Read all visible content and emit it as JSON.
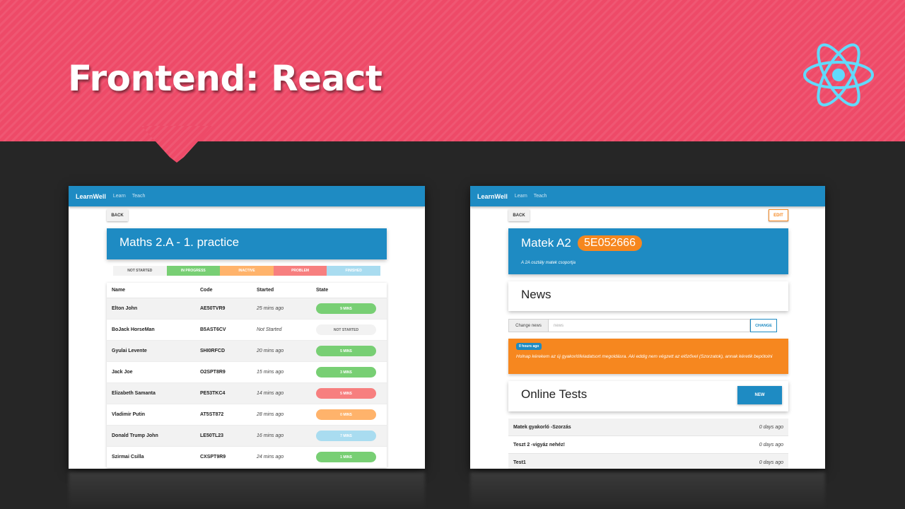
{
  "slide": {
    "title": "Frontend: React",
    "colors": {
      "banner": "#ee4a68",
      "background": "#262626",
      "react": "#61dafb"
    },
    "logo_icon": "react-atom-icon"
  },
  "left_app": {
    "nav": {
      "brand": "LearnWell",
      "links": [
        "Learn",
        "Teach"
      ]
    },
    "back_label": "BACK",
    "practice_title": "Maths 2.A - 1. practice",
    "legend": [
      {
        "label": "NOT STARTED",
        "color": "#f2f2f2",
        "text_color": "#555555"
      },
      {
        "label": "IN PROGRESS",
        "color": "#78cf74",
        "text_color": "#ffffff"
      },
      {
        "label": "INACTIVE",
        "color": "#ffb36b",
        "text_color": "#ffffff"
      },
      {
        "label": "PROBLEM",
        "color": "#f77f7f",
        "text_color": "#ffffff"
      },
      {
        "label": "FINISHED",
        "color": "#a9dcf0",
        "text_color": "#ffffff"
      }
    ],
    "columns": [
      "Name",
      "Code",
      "Started",
      "State"
    ],
    "rows": [
      {
        "name": "Elton John",
        "code": "AE50TVR9",
        "started": "25 mins ago",
        "state": "9 MINS",
        "state_color": "#78cf74"
      },
      {
        "name": "BoJack HorseMan",
        "code": "B5AST6CV",
        "started": "Not Started",
        "state": "NOT STARTED",
        "state_color": "#f2f2f2"
      },
      {
        "name": "Gyulai Levente",
        "code": "SHI0RFCD",
        "started": "20 mins ago",
        "state": "5 MINS",
        "state_color": "#78cf74"
      },
      {
        "name": "Jack Joe",
        "code": "O2SPT8R9",
        "started": "15 mins ago",
        "state": "3 MINS",
        "state_color": "#78cf74"
      },
      {
        "name": "Elizabeth Samanta",
        "code": "PE53TKC4",
        "started": "14 mins ago",
        "state": "5 MINS",
        "state_color": "#f77f7f"
      },
      {
        "name": "Vladimir Putin",
        "code": "AT5ST872",
        "started": "28 mins ago",
        "state": "0 MINS",
        "state_color": "#ffb36b"
      },
      {
        "name": "Donald Trump John",
        "code": "LE50TL23",
        "started": "16 mins ago",
        "state": "7 MINS",
        "state_color": "#a9dcf0"
      },
      {
        "name": "Szirmai Csilla",
        "code": "CXSPT9R9",
        "started": "24 mins ago",
        "state": "1 MINS",
        "state_color": "#78cf74"
      }
    ]
  },
  "right_app": {
    "nav": {
      "brand": "LearnWell",
      "links": [
        "Learn",
        "Teach"
      ]
    },
    "back_label": "BACK",
    "edit_label": "EDIT",
    "group_name": "Matek A2",
    "group_code": "5E052666",
    "group_description": "A 2A osztály matek csoportja",
    "news_title": "News",
    "news_input_label": "Change news",
    "news_input_placeholder": "news",
    "news_change_label": "CHANGE",
    "news_item": {
      "badge": "0 hours ago",
      "text": "Holnap kérekem az új gyakorlófeladatsort megoldásra. Aki eddig nem végzett az előzővel (Szorzatok), annak kéretik bepótolni"
    },
    "tests_title": "Online Tests",
    "new_label": "NEW",
    "tests": [
      {
        "name": "Matek gyakorló -Szorzás",
        "time": "0 days ago"
      },
      {
        "name": "Teszt 2 -vigyáz nehéz!",
        "time": "0 days ago"
      },
      {
        "name": "Test1",
        "time": "0 days ago"
      }
    ]
  }
}
